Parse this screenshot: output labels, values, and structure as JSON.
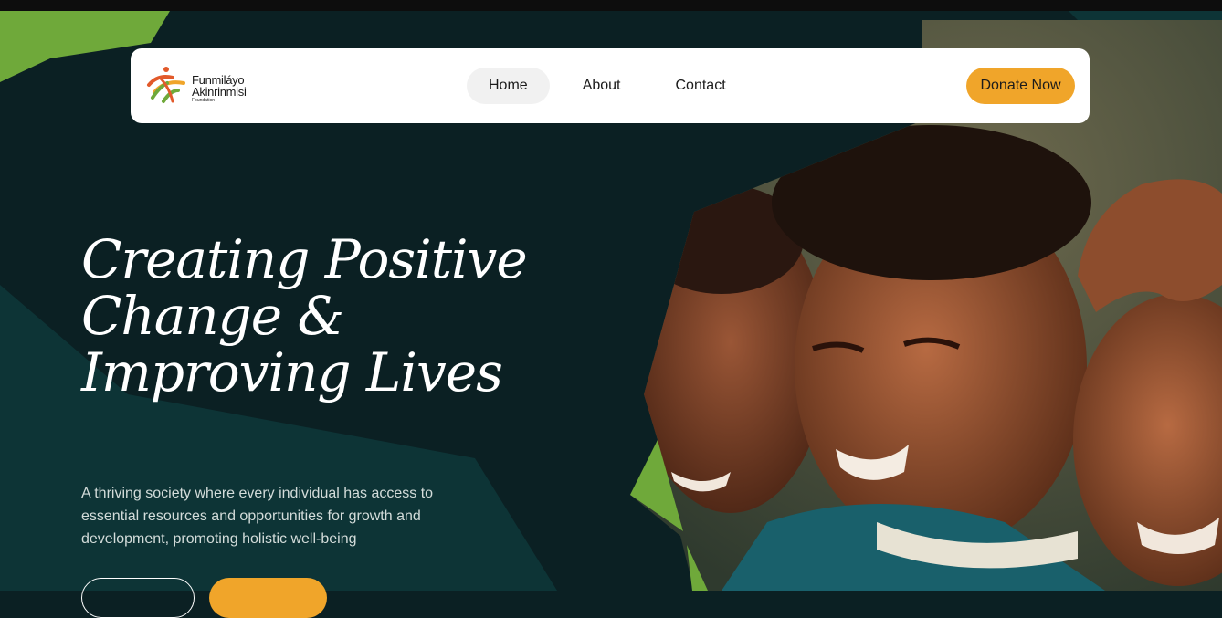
{
  "brand": {
    "name_line1": "Funmiláyo",
    "name_line2": "Akinrinmisi",
    "name_line3": "Foundation"
  },
  "nav": {
    "items": [
      {
        "label": "Home",
        "active": true
      },
      {
        "label": "About",
        "active": false
      },
      {
        "label": "Contact",
        "active": false
      }
    ],
    "donate_label": "Donate Now"
  },
  "hero": {
    "title": "Creating Positive Change & Improving Lives",
    "subtitle": "A thriving society where every individual has access to essential resources and opportunities for growth and development, promoting holistic well-being"
  },
  "colors": {
    "background": "#0b2023",
    "panel_teal": "#0d3436",
    "accent_green": "#6fa93a",
    "accent_orange": "#f0a52a"
  }
}
